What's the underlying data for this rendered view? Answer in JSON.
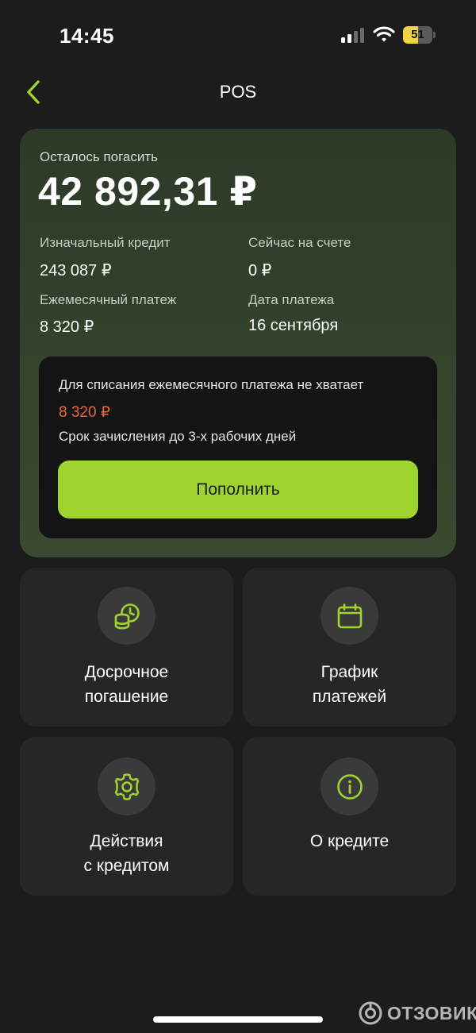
{
  "status_bar": {
    "time": "14:45",
    "battery_level": "51",
    "battery_percent": 51
  },
  "nav": {
    "title": "POS",
    "back_icon": "chevron-left-icon"
  },
  "loan": {
    "remaining_label": "Осталось погасить",
    "remaining_amount": "42 892,31 ₽",
    "initial_credit_label": "Изначальный кредит",
    "initial_credit_value": "243 087 ₽",
    "account_balance_label": "Сейчас на счете",
    "account_balance_value": "0 ₽",
    "monthly_payment_label": "Ежемесячный платеж",
    "monthly_payment_value": "8 320 ₽",
    "payment_date_label": "Дата платежа",
    "payment_date_value": "16 сентября"
  },
  "alert": {
    "text": "Для списания ежемесячного платежа не хватает",
    "amount": "8 320 ₽",
    "sub_text": "Срок зачисления до 3-х рабочих дней",
    "button_label": "Пополнить"
  },
  "tiles": [
    {
      "label": "Досрочное\nпогашение",
      "icon": "coins-clock-icon"
    },
    {
      "label": "График\nплатежей",
      "icon": "calendar-icon"
    },
    {
      "label": "Действия\nс кредитом",
      "icon": "gear-icon"
    },
    {
      "label": "О кредите",
      "icon": "info-icon"
    }
  ],
  "watermark": {
    "text": "ОТЗОВИК"
  },
  "colors": {
    "accent": "#9fd42e",
    "warning": "#e8663b",
    "background": "#1c1c1c",
    "tile": "#262626"
  }
}
